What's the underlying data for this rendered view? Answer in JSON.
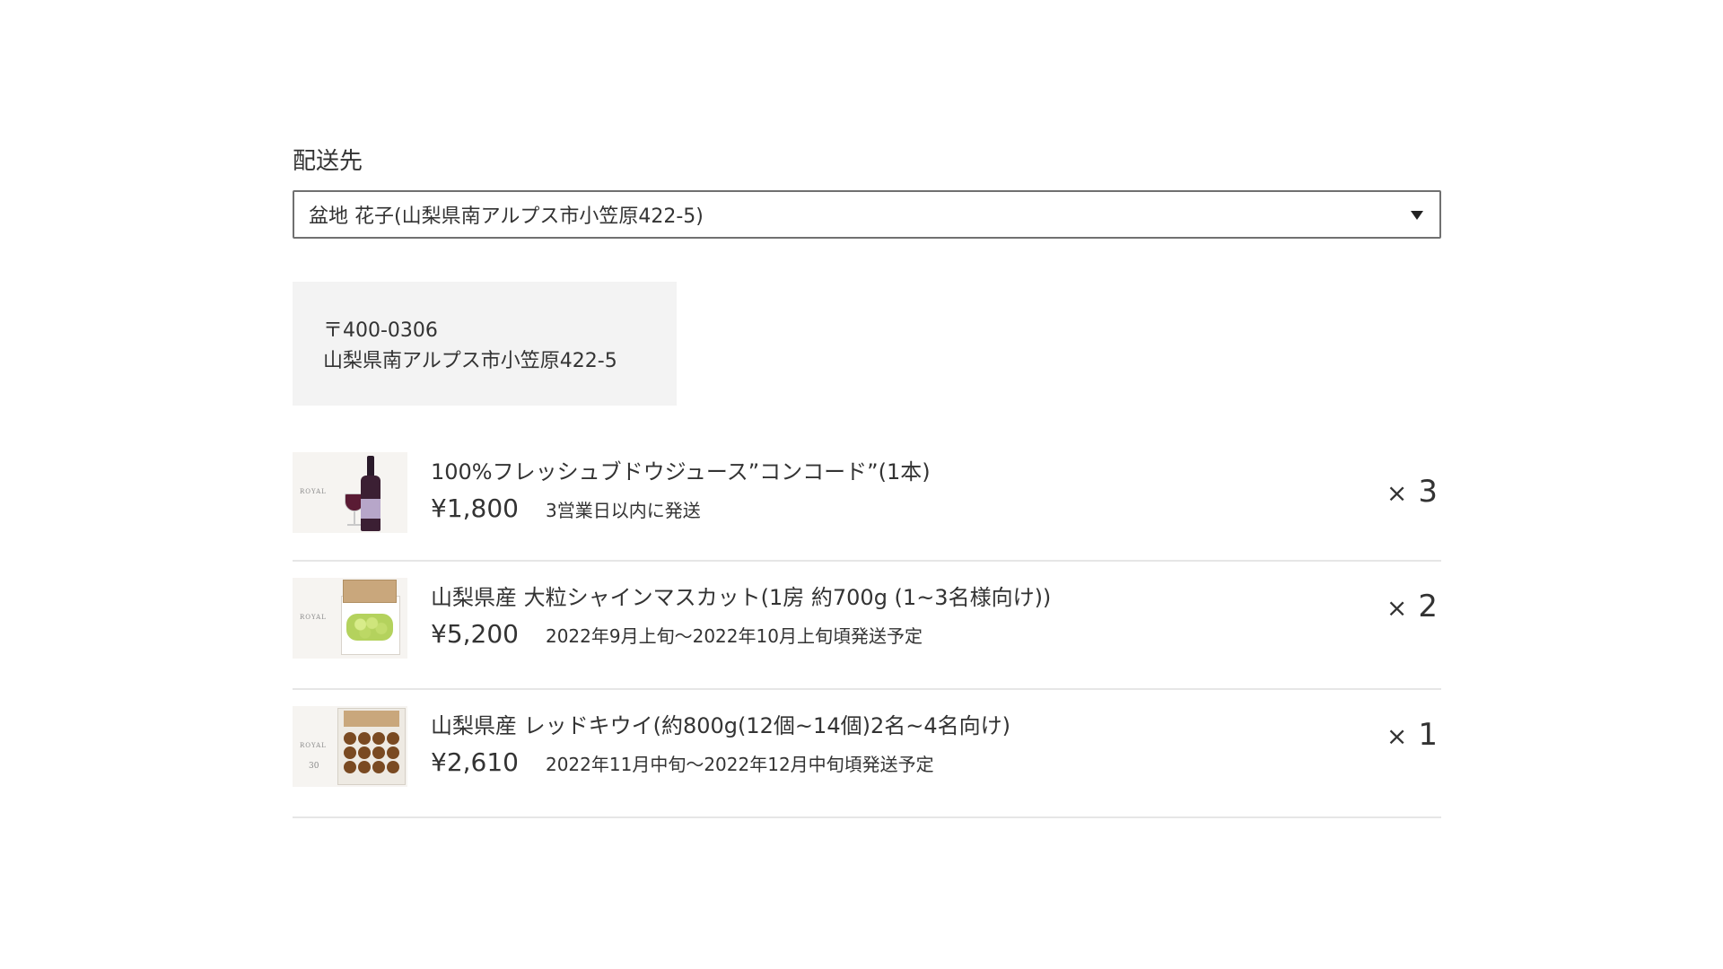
{
  "delivery": {
    "label": "配送先",
    "selected": "盆地 花子(山梨県南アルプス市小笠原422-5)",
    "postal": "〒400-0306",
    "address": "山梨県南アルプス市小笠原422-5"
  },
  "items": [
    {
      "name": "100%フレッシュブドウジュース”コンコード”(1本)",
      "price": "¥1,800",
      "shipping": "3営業日以内に発送",
      "qty_symbol": "×",
      "qty": "3",
      "thumb_brand": "ROYAL"
    },
    {
      "name": "山梨県産 大粒シャインマスカット(1房 約700g (1~3名様向け))",
      "price": "¥5,200",
      "shipping": "2022年9月上旬〜2022年10月上旬頃発送予定",
      "qty_symbol": "×",
      "qty": "2",
      "thumb_brand": "ROYAL"
    },
    {
      "name": "山梨県産 レッドキウイ(約800g(12個~14個)2名~4名向け)",
      "price": "¥2,610",
      "shipping": "2022年11月中旬〜2022年12月中旬頃発送予定",
      "qty_symbol": "×",
      "qty": "1",
      "thumb_brand": "ROYAL",
      "thumb_badge": "30"
    }
  ]
}
